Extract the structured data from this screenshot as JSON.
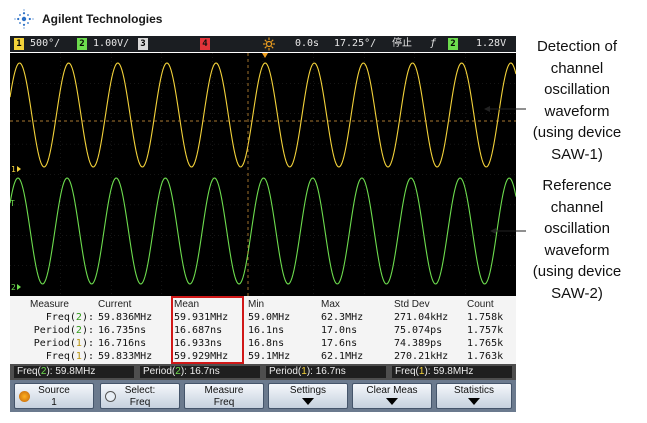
{
  "brand": {
    "name": "Agilent Technologies"
  },
  "status_bar": {
    "ch1_num": "1",
    "ch1_scale": "500°/",
    "ch2_num": "2",
    "ch2_scale": "1.00V/",
    "ch3_num": "3",
    "ch4_num": "4",
    "trigger_delay": "0.0s",
    "timebase": "17.25°/",
    "run_state": "停止",
    "trigger_slope": "ƒ",
    "trigger_ch": "2",
    "trigger_level": "1.28V"
  },
  "colors": {
    "ch1": "#f3d23a",
    "ch2": "#6ddc4e",
    "meas_highlight": "#d01818",
    "screen_bg": "#000000"
  },
  "waveforms": {
    "ch1": {
      "cycles_shown": 10.3,
      "color": "ch1"
    },
    "ch2": {
      "cycles_shown": 10.3,
      "color": "ch2"
    }
  },
  "measurements": {
    "headers": [
      "Measure",
      "Current",
      "Mean",
      "Min",
      "Max",
      "Std Dev",
      "Count"
    ],
    "rows": [
      {
        "label": "Freq(",
        "src": "2",
        "values": [
          "59.836MHz",
          "59.931MHz",
          "59.0MHz",
          "62.3MHz",
          "271.04kHz",
          "1.758k"
        ]
      },
      {
        "label": "Period(",
        "src": "2",
        "values": [
          "16.735ns",
          "16.687ns",
          "16.1ns",
          "17.0ns",
          "75.074ps",
          "1.757k"
        ]
      },
      {
        "label": "Period(",
        "src": "1",
        "values": [
          "16.716ns",
          "16.933ns",
          "16.8ns",
          "17.6ns",
          "74.389ps",
          "1.765k"
        ]
      },
      {
        "label": "Freq(",
        "src": "1",
        "values": [
          "59.833MHz",
          "59.929MHz",
          "59.1MHz",
          "62.1MHz",
          "270.21kHz",
          "1.763k"
        ]
      }
    ]
  },
  "readouts": [
    {
      "pre": "Freq(",
      "src": "2",
      "post": "): 59.8MHz"
    },
    {
      "pre": "Period(",
      "src": "2",
      "post": "): 16.7ns"
    },
    {
      "pre": "Period(",
      "src": "1",
      "post": "): 16.7ns"
    },
    {
      "pre": "Freq(",
      "src": "1",
      "post": "): 59.8MHz"
    }
  ],
  "softkeys": {
    "source": {
      "line1": "Source",
      "line2": "1"
    },
    "select": {
      "line1": "Select:",
      "line2": "Freq"
    },
    "measure": {
      "line1": "Measure",
      "line2": "Freq"
    },
    "settings": {
      "line1": "Settings"
    },
    "clear": {
      "line1": "Clear Meas"
    },
    "statistics": {
      "line1": "Statistics"
    }
  },
  "annotations": {
    "detection": [
      "Detection of",
      "channel",
      "oscillation",
      "waveform",
      "(using device",
      "SAW-1)"
    ],
    "reference": [
      "Reference",
      "channel",
      "oscillation",
      "waveform",
      "(using device",
      "SAW-2)"
    ]
  }
}
